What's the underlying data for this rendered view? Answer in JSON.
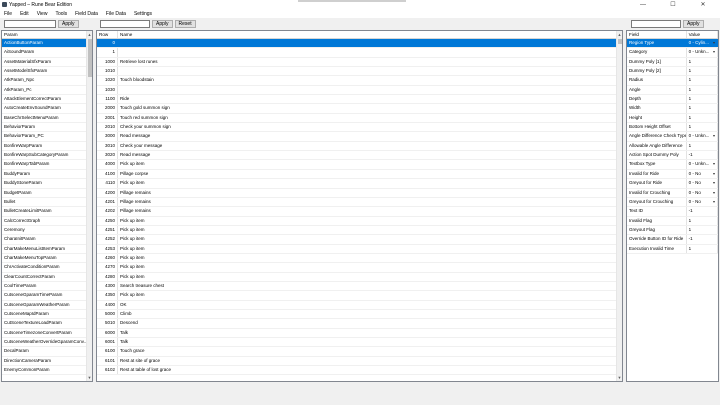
{
  "window": {
    "title": "Yapped – Rune Bear Edition",
    "minimize": "—",
    "maximize": "☐",
    "close": "✕"
  },
  "menu": [
    "File",
    "Edit",
    "View",
    "Tools",
    "Field Data",
    "File Data",
    "Settings"
  ],
  "params_panel": {
    "filter_value": "",
    "apply_label": "Apply",
    "header": "Param",
    "items": [
      "ActionButtonParam",
      "AiSoundParam",
      "AssetMaterialSfxParam",
      "AssetModelSfxParam",
      "AtkParam_Npc",
      "AtkParam_Pc",
      "AttackElementCorrectParam",
      "AutoCreateEnvSoundParam",
      "BaseChrSelectMenuParam",
      "BehaviorParam",
      "BehaviorParam_PC",
      "BonfireWarpParam",
      "BonfireWarpSubCategoryParam",
      "BonfireWarpTabParam",
      "BuddyParam",
      "BuddyStoneParam",
      "BudgetParam",
      "Bullet",
      "BulletCreateLimitParam",
      "CalcCorrectGraph",
      "Ceremony",
      "CharaInitParam",
      "CharMakeMenuListItemParam",
      "CharMakeMenuTopParam",
      "ChrActivateConditionParam",
      "ClearCountCorrectParam",
      "CoolTimeParam",
      "CutsceneGparamTimeParam",
      "CutsceneGparamWeatherParam",
      "CutsceneMapIdParam",
      "CutSceneTextureLoadParam",
      "CutsceneTimezoneConvertParam",
      "CutsceneWeatherOverrideGparamConv...",
      "DecalParam",
      "DirectionCameraParam",
      "EnemyCommonParam"
    ]
  },
  "rows_panel": {
    "filter_value": "",
    "apply_label": "Apply",
    "reset_label": "Reset",
    "headers": [
      "Row",
      "Name"
    ],
    "rows": [
      {
        "id": "0",
        "name": ""
      },
      {
        "id": "1",
        "name": ""
      },
      {
        "id": "1000",
        "name": "Retrieve lost runes"
      },
      {
        "id": "1010",
        "name": ""
      },
      {
        "id": "1020",
        "name": "Touch bloodstain"
      },
      {
        "id": "1030",
        "name": ""
      },
      {
        "id": "1100",
        "name": "Ride"
      },
      {
        "id": "2000",
        "name": "Touch gold summon sign"
      },
      {
        "id": "2001",
        "name": "Touch red summon sign"
      },
      {
        "id": "2010",
        "name": "Check your summon sign"
      },
      {
        "id": "3000",
        "name": "Read message"
      },
      {
        "id": "3010",
        "name": "Check your message"
      },
      {
        "id": "3020",
        "name": "Read message"
      },
      {
        "id": "4000",
        "name": "Pick up item"
      },
      {
        "id": "4100",
        "name": "Pillage corpse"
      },
      {
        "id": "4110",
        "name": "Pick up item"
      },
      {
        "id": "4200",
        "name": "Pillage remains"
      },
      {
        "id": "4201",
        "name": "Pillage remains"
      },
      {
        "id": "4202",
        "name": "Pillage remains"
      },
      {
        "id": "4250",
        "name": "Pick up item"
      },
      {
        "id": "4251",
        "name": "Pick up item"
      },
      {
        "id": "4252",
        "name": "Pick up item"
      },
      {
        "id": "4253",
        "name": "Pick up item"
      },
      {
        "id": "4260",
        "name": "Pick up item"
      },
      {
        "id": "4270",
        "name": "Pick up item"
      },
      {
        "id": "4280",
        "name": "Pick up item"
      },
      {
        "id": "4300",
        "name": "Search treasure chest"
      },
      {
        "id": "4350",
        "name": "Pick up item"
      },
      {
        "id": "4400",
        "name": "OK"
      },
      {
        "id": "5000",
        "name": "Climb"
      },
      {
        "id": "5010",
        "name": "Descend"
      },
      {
        "id": "6000",
        "name": "Talk"
      },
      {
        "id": "6001",
        "name": "Talk"
      },
      {
        "id": "6100",
        "name": "Touch grace"
      },
      {
        "id": "6101",
        "name": "Rest at site of grace"
      },
      {
        "id": "6102",
        "name": "Rest at table of lost grace"
      }
    ]
  },
  "fields_panel": {
    "filter_value": "",
    "apply_label": "Apply",
    "headers": [
      "Field",
      "Value"
    ],
    "rows": [
      {
        "field": "Region Type",
        "value": "0 - Cylin...",
        "combo": true
      },
      {
        "field": "Category",
        "value": "0 - Unkn...",
        "combo": true
      },
      {
        "field": "Dummy Poly [1]",
        "value": "1",
        "combo": false
      },
      {
        "field": "Dummy Poly [2]",
        "value": "1",
        "combo": false
      },
      {
        "field": "Radius",
        "value": "1",
        "combo": false
      },
      {
        "field": "Angle",
        "value": "1",
        "combo": false
      },
      {
        "field": "Depth",
        "value": "1",
        "combo": false
      },
      {
        "field": "Width",
        "value": "1",
        "combo": false
      },
      {
        "field": "Height",
        "value": "1",
        "combo": false
      },
      {
        "field": "Bottom Height Offset",
        "value": "1",
        "combo": false
      },
      {
        "field": "Angle Difference Check Type",
        "value": "0 - Unkn...",
        "combo": true
      },
      {
        "field": "Allowable Angle Difference",
        "value": "1",
        "combo": false
      },
      {
        "field": "Action Spot Dummy Poly",
        "value": "-1",
        "combo": false
      },
      {
        "field": "Textbox Type",
        "value": "0 - Unkn...",
        "combo": true
      },
      {
        "field": "Invalid for Ride",
        "value": "0 - No",
        "combo": true
      },
      {
        "field": "Greyout for Ride",
        "value": "0 - No",
        "combo": true
      },
      {
        "field": "Invalid for Crouching",
        "value": "0 - No",
        "combo": true
      },
      {
        "field": "Greyout for Crouching",
        "value": "0 - No",
        "combo": true
      },
      {
        "field": "Text ID",
        "value": "-1",
        "combo": false
      },
      {
        "field": "Invalid Flag",
        "value": "1",
        "combo": false
      },
      {
        "field": "Greyout Flag",
        "value": "1",
        "combo": false
      },
      {
        "field": "Override Button ID for Ride",
        "value": "-1",
        "combo": false
      },
      {
        "field": "Execution Invalid Time",
        "value": "1",
        "combo": false
      }
    ]
  }
}
